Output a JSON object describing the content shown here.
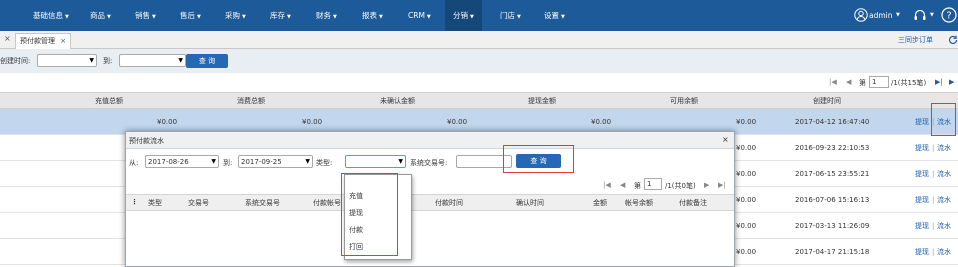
{
  "nav": {
    "items": [
      {
        "label": "基础信息",
        "dropdown": true
      },
      {
        "label": "商品",
        "dropdown": true
      },
      {
        "label": "销售",
        "dropdown": true
      },
      {
        "label": "售后",
        "dropdown": true
      },
      {
        "label": "采购",
        "dropdown": true
      },
      {
        "label": "库存",
        "dropdown": true
      },
      {
        "label": "财务",
        "dropdown": true
      },
      {
        "label": "报表",
        "dropdown": true
      },
      {
        "label": "CRM",
        "dropdown": true
      },
      {
        "label": "分销",
        "dropdown": true,
        "active": true
      },
      {
        "label": "门店",
        "dropdown": true
      },
      {
        "label": "设置",
        "dropdown": true
      }
    ],
    "user": "admin",
    "colors": {
      "bar": "#1d5a99",
      "active": "#154779"
    }
  },
  "tabs": [
    {
      "label": "预付款管理",
      "close": "×",
      "active": true
    }
  ],
  "tabbar": {
    "left_close": "×",
    "sync_label": "三同步订单",
    "refresh_icon": "refresh-icon"
  },
  "filter": {
    "created_label": "创建时间:",
    "to_label": "到:",
    "query_label": "查 询"
  },
  "pager": {
    "page_label": "第",
    "page_value": "1",
    "total_text": "/1(共15笔)"
  },
  "grid": {
    "columns": [
      "充值总额",
      "消费总额",
      "未确认金额",
      "提现金额",
      "可用余额",
      "创建时间"
    ],
    "rows": [
      {
        "recharge": "¥0.00",
        "consume": "¥0.00",
        "unconfirmed": "¥0.00",
        "withdraw": "¥0.00",
        "available": "¥0.00",
        "created": "2017-04-12 16:47:40",
        "selected": true
      },
      {
        "recharge": "",
        "consume": "",
        "unconfirmed": "",
        "withdraw": "",
        "available": "¥0.00",
        "created": "2016-09-23 22:10:53"
      },
      {
        "recharge": "",
        "consume": "",
        "unconfirmed": "",
        "withdraw": "",
        "available": "¥0.00",
        "created": "2017-06-15 23:55:21"
      },
      {
        "recharge": "",
        "consume": "",
        "unconfirmed": "",
        "withdraw": "",
        "available": "¥0.00",
        "created": "2016-07-06 15:16:13"
      },
      {
        "recharge": "",
        "consume": "",
        "unconfirmed": "",
        "withdraw": "",
        "available": "¥0.00",
        "created": "2017-03-13 11:26:09"
      },
      {
        "recharge": "",
        "consume": "",
        "unconfirmed": "",
        "withdraw": "",
        "available": "¥0.00",
        "created": "2017-04-17 21:15:18"
      }
    ],
    "action_withdraw": "提现",
    "action_sep": "|",
    "action_flow": "流水"
  },
  "modal": {
    "title": "预付款流水",
    "close": "×",
    "from_label": "从:",
    "from_value": "2017-08-26",
    "to_label": "到:",
    "to_value": "2017-09-25",
    "type_label": "类型:",
    "type_value": "",
    "sys_no_label": "系统交易号:",
    "sys_no_value": "",
    "query_label": "查 询",
    "pager": {
      "page_label": "第",
      "page_value": "1",
      "total_text": "/1(共0笔)"
    },
    "columns": [
      "类型",
      "交易号",
      "系统交易号",
      "付款帐号",
      "付款时间",
      "确认时间",
      "金额",
      "帐号余额",
      "付款备注"
    ],
    "type_options": [
      "充值",
      "提现",
      "付款",
      "打回"
    ]
  },
  "colors": {
    "highlight_box": "#e23a3a",
    "link": "#1d5da8",
    "selected_row": "#c2d7ee"
  }
}
